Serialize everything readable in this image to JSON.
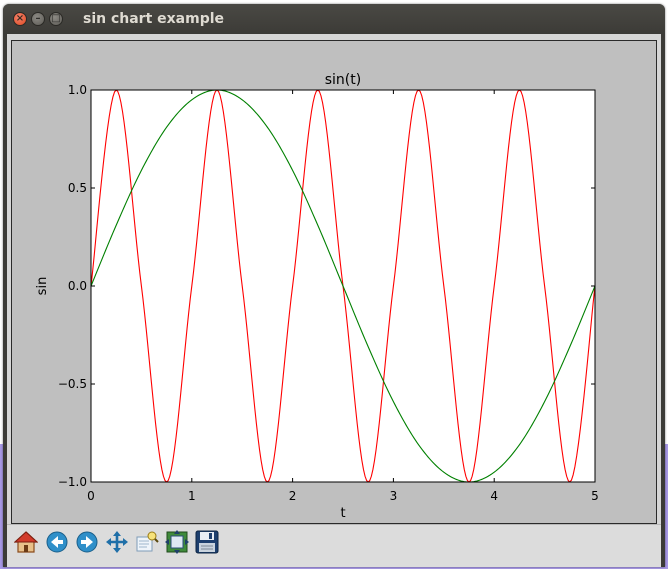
{
  "window": {
    "title": "sin chart example"
  },
  "toolbar": {
    "buttons": [
      {
        "icon": "home-icon"
      },
      {
        "icon": "back-arrow-icon"
      },
      {
        "icon": "forward-arrow-icon"
      },
      {
        "icon": "pan-move-icon"
      },
      {
        "icon": "zoom-to-rect-icon"
      },
      {
        "icon": "configure-subplots-icon"
      },
      {
        "icon": "save-figure-icon"
      }
    ]
  },
  "chart_data": {
    "type": "line",
    "title": "sin(t)",
    "xlabel": "t",
    "ylabel": "sin",
    "xlim": [
      0,
      5
    ],
    "ylim": [
      -1.0,
      1.0
    ],
    "xticks": [
      0,
      1,
      2,
      3,
      4,
      5
    ],
    "xtick_labels": [
      "0",
      "1",
      "2",
      "3",
      "4",
      "5"
    ],
    "yticks": [
      1.0,
      0.5,
      0.0,
      -0.5,
      -1.0
    ],
    "ytick_labels": [
      "1.0",
      "0.5",
      "0.0",
      "−0.5",
      "−1.0"
    ],
    "grid": false,
    "series": [
      {
        "color": "#ff0000",
        "x": [
          0,
          0.25,
          0.5,
          0.75,
          1,
          1.25,
          1.5,
          1.75,
          2,
          2.25,
          2.5,
          2.75,
          3,
          3.25,
          3.5,
          3.75,
          4,
          4.25,
          4.5,
          4.75,
          5
        ],
        "y": [
          0,
          1,
          0,
          -1,
          0,
          1,
          0,
          -1,
          0,
          1,
          0,
          -1,
          0,
          1,
          0,
          -1,
          0,
          1,
          0,
          -1,
          0
        ]
      },
      {
        "color": "#008000",
        "x": [
          0,
          0.25,
          0.5,
          0.75,
          1,
          1.25,
          1.5,
          1.75,
          2,
          2.25,
          2.5,
          2.75,
          3,
          3.25,
          3.5,
          3.75,
          4,
          4.25,
          4.5,
          4.75,
          5
        ],
        "y": [
          0,
          0.31,
          0.59,
          0.81,
          0.95,
          1,
          0.95,
          0.81,
          0.59,
          0.31,
          0,
          -0.31,
          -0.59,
          -0.81,
          -0.95,
          -1,
          -0.95,
          -0.81,
          -0.59,
          -0.31,
          0
        ]
      }
    ]
  }
}
